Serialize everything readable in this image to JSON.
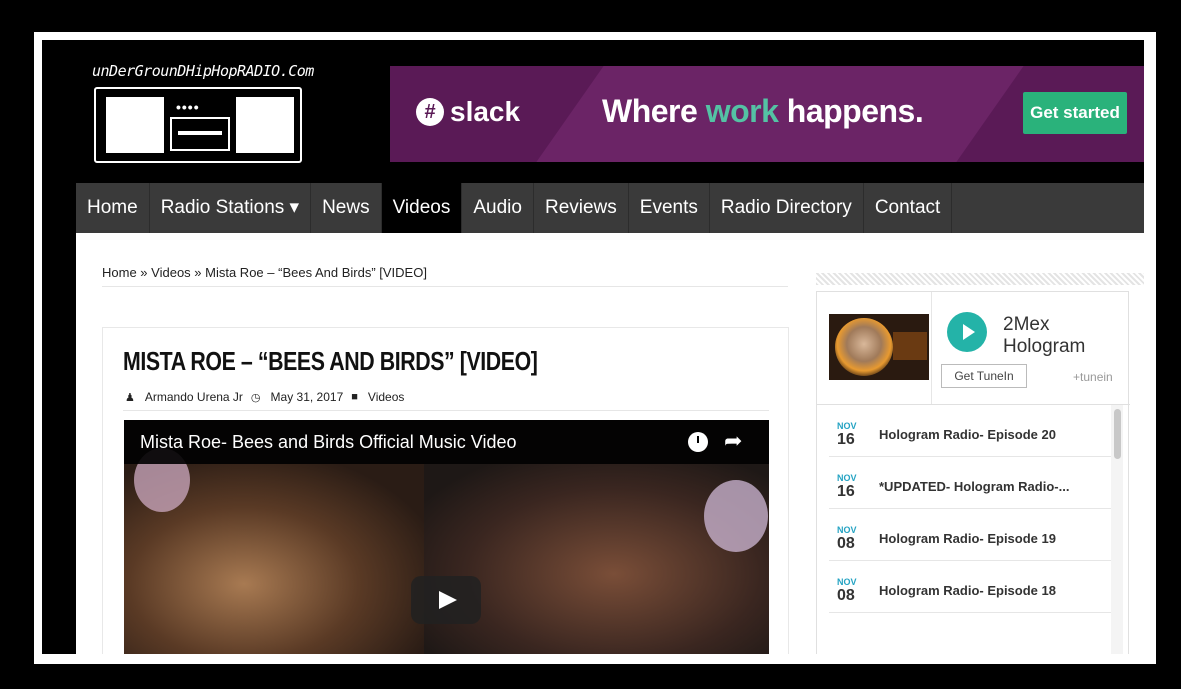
{
  "logo": {
    "text": "unDerGrounDHipHopRADIO.Com",
    "dots": "••••"
  },
  "ad": {
    "brand": "slack",
    "tagline_part1": "Where ",
    "tagline_highlight": "work",
    "tagline_part2": " happens.",
    "cta": "Get started",
    "colors": {
      "background": "#5a1a56",
      "accent": "#2ab27b",
      "highlight": "#54c2a4"
    }
  },
  "nav": {
    "items": [
      {
        "label": "Home"
      },
      {
        "label": "Radio Stations ▾"
      },
      {
        "label": "News"
      },
      {
        "label": "Videos"
      },
      {
        "label": "Audio"
      },
      {
        "label": "Reviews"
      },
      {
        "label": "Events"
      },
      {
        "label": "Radio Directory"
      },
      {
        "label": "Contact"
      }
    ],
    "active": "Videos"
  },
  "breadcrumb": {
    "home": "Home",
    "sep": " » ",
    "section": "Videos",
    "current": "Mista Roe – “Bees And Birds” [VIDEO]"
  },
  "post": {
    "title": "MISTA ROE – “BEES AND BIRDS” [VIDEO]",
    "author": "Armando Urena Jr",
    "date": "May 31, 2017",
    "category": "Videos",
    "video_title": "Mista Roe- Bees and Birds Official Music Video"
  },
  "tunein": {
    "name_line1": "2Mex",
    "name_line2": "Hologram",
    "button": "Get TuneIn",
    "brand": "+tunein",
    "episodes": [
      {
        "month": "NOV",
        "day": "16",
        "title": "Hologram Radio- Episode 20"
      },
      {
        "month": "NOV",
        "day": "16",
        "title": "*UPDATED- Hologram Radio-..."
      },
      {
        "month": "NOV",
        "day": "08",
        "title": "Hologram Radio- Episode 19"
      },
      {
        "month": "NOV",
        "day": "08",
        "title": "Hologram Radio- Episode 18"
      }
    ]
  }
}
